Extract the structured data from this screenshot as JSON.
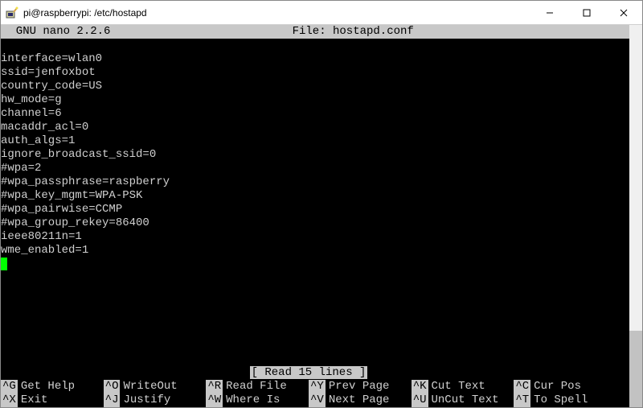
{
  "window": {
    "title": "pi@raspberrypi: /etc/hostapd"
  },
  "nano": {
    "program": "  GNU nano 2.2.6",
    "file_label": "File: hostapd.conf"
  },
  "editor_lines": [
    "interface=wlan0",
    "ssid=jenfoxbot",
    "country_code=US",
    "hw_mode=g",
    "channel=6",
    "macaddr_acl=0",
    "auth_algs=1",
    "ignore_broadcast_ssid=0",
    "#wpa=2",
    "#wpa_passphrase=raspberry",
    "#wpa_key_mgmt=WPA-PSK",
    "#wpa_pairwise=CCMP",
    "#wpa_group_rekey=86400",
    "ieee80211n=1",
    "wme_enabled=1"
  ],
  "status": "[ Read 15 lines ]",
  "shortcuts_row1": [
    {
      "key": "^G",
      "label": "Get Help"
    },
    {
      "key": "^O",
      "label": "WriteOut"
    },
    {
      "key": "^R",
      "label": "Read File"
    },
    {
      "key": "^Y",
      "label": "Prev Page"
    },
    {
      "key": "^K",
      "label": "Cut Text"
    },
    {
      "key": "^C",
      "label": "Cur Pos"
    }
  ],
  "shortcuts_row2": [
    {
      "key": "^X",
      "label": "Exit"
    },
    {
      "key": "^J",
      "label": "Justify"
    },
    {
      "key": "^W",
      "label": "Where Is"
    },
    {
      "key": "^V",
      "label": "Next Page"
    },
    {
      "key": "^U",
      "label": "UnCut Text"
    },
    {
      "key": "^T",
      "label": "To Spell"
    }
  ],
  "scrollbar": {
    "thumb_top_pct": 80,
    "thumb_height_pct": 20
  }
}
